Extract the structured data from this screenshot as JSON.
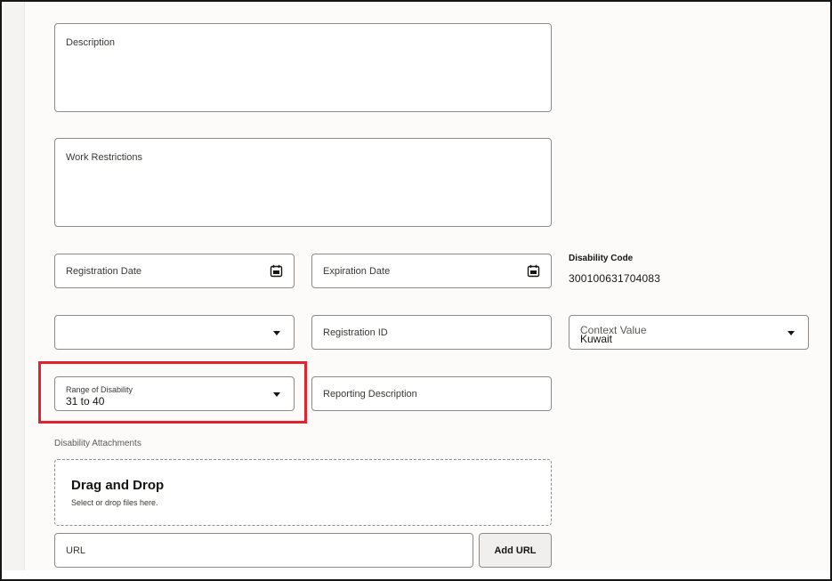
{
  "form": {
    "description_label": "Description",
    "work_restrictions_label": "Work Restrictions",
    "registration_date_label": "Registration Date",
    "expiration_date_label": "Expiration Date",
    "disability_code_label": "Disability Code",
    "disability_code_value": "300100631704083",
    "unlabeled_select_value": "",
    "registration_id_label": "Registration ID",
    "context_value_label": "Context Value",
    "context_value_value": "Kuwait",
    "range_of_disability_label": "Range of Disability",
    "range_of_disability_value": "31 to 40",
    "reporting_description_label": "Reporting Description"
  },
  "attachments": {
    "section_label": "Disability Attachments",
    "drop_title": "Drag and Drop",
    "drop_subtitle": "Select or drop files here.",
    "url_label": "URL",
    "add_url_button": "Add URL"
  },
  "icons": {
    "calendar": "calendar-icon",
    "dropdown": "chevron-down-icon"
  },
  "colors": {
    "highlight": "#e3232c"
  }
}
